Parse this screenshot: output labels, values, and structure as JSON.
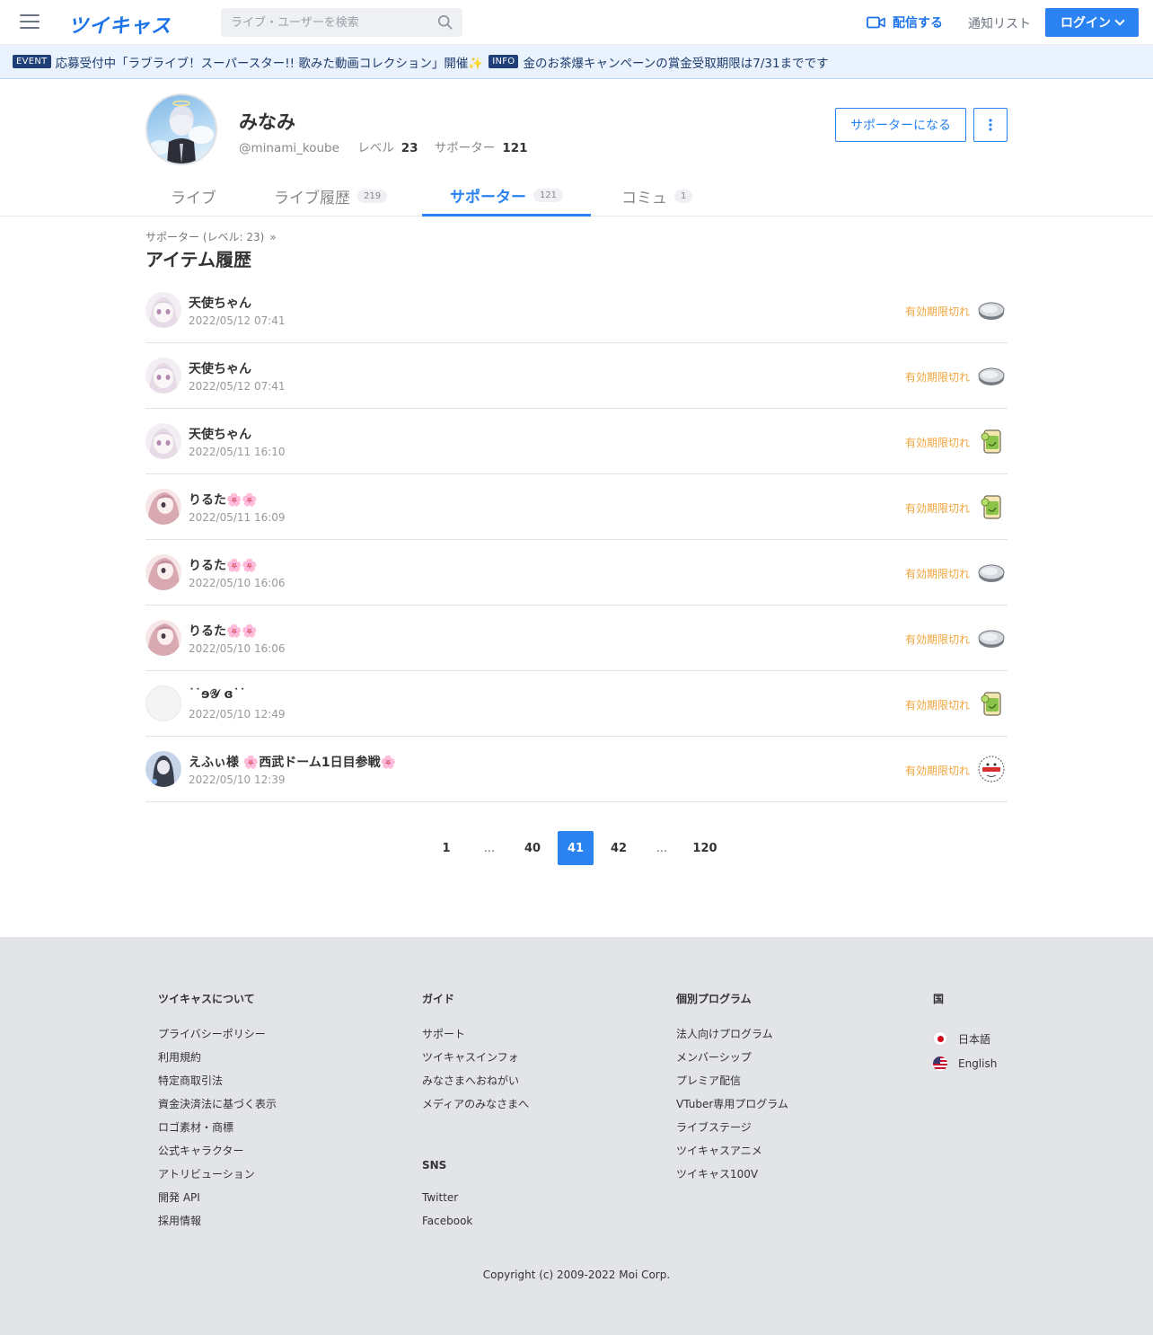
{
  "header": {
    "logo": "ツイキャス",
    "search_placeholder": "ライブ・ユーザーを検索",
    "broadcast": "配信する",
    "notify": "通知リスト",
    "login": "ログイン"
  },
  "eventbar": [
    {
      "tag": "EVENT",
      "text": "応募受付中「ラブライブ！スーパースター!! 歌みた動画コレクション」開催✨"
    },
    {
      "tag": "INFO",
      "text": "金のお茶爆キャンペーンの賞金受取期限は7/31までです"
    }
  ],
  "profile": {
    "name": "みなみ",
    "handle": "@minami_koube",
    "level_label": "レベル",
    "level": "23",
    "supporter_label": "サポーター",
    "supporters": "121",
    "become_supporter": "サポーターになる"
  },
  "tabs": [
    {
      "label": "ライブ",
      "count": ""
    },
    {
      "label": "ライブ履歴",
      "count": "219"
    },
    {
      "label": "サポーター",
      "count": "121"
    },
    {
      "label": "コミュ",
      "count": "1"
    }
  ],
  "breadcrumb": "サポーター (レベル: 23)",
  "breadcrumb_arrow": "»",
  "section_title": "アイテム履歴",
  "items": [
    {
      "name": "天使ちゃん",
      "date": "2022/05/12 07:41",
      "status": "有効期限切れ",
      "item": "coin-icon",
      "avatar": "angel"
    },
    {
      "name": "天使ちゃん",
      "date": "2022/05/12 07:41",
      "status": "有効期限切れ",
      "item": "coin-icon",
      "avatar": "angel"
    },
    {
      "name": "天使ちゃん",
      "date": "2022/05/11 16:10",
      "status": "有効期限切れ",
      "item": "tea-icon",
      "avatar": "angel"
    },
    {
      "name": "りるた🌸🌸",
      "date": "2022/05/11 16:09",
      "status": "有効期限切れ",
      "item": "tea-icon",
      "avatar": "pink"
    },
    {
      "name": "りるた🌸🌸",
      "date": "2022/05/10 16:06",
      "status": "有効期限切れ",
      "item": "coin-icon",
      "avatar": "pink"
    },
    {
      "name": "りるた🌸🌸",
      "date": "2022/05/10 16:06",
      "status": "有効期限切れ",
      "item": "coin-icon",
      "avatar": "pink"
    },
    {
      "name": "˙˙ɘ𝒴 ɞ˙˙",
      "date": "2022/05/10 12:49",
      "status": "有効期限切れ",
      "item": "tea-icon",
      "avatar": "blank"
    },
    {
      "name": "えふぃ様 🌸西武ドーム1日目参戦🌸",
      "date": "2022/05/10 12:39",
      "status": "有効期限切れ",
      "item": "gift-icon",
      "avatar": "dark"
    }
  ],
  "pagination": [
    "1",
    "...",
    "40",
    "41",
    "42",
    "...",
    "120"
  ],
  "pagination_active": "41",
  "footer": {
    "about": {
      "title": "ツイキャスについて",
      "links": [
        "プライバシーポリシー",
        "利用規約",
        "特定商取引法",
        "資金決済法に基づく表示",
        "ロゴ素材・商標",
        "公式キャラクター",
        "アトリビューション",
        "開発 API",
        "採用情報"
      ]
    },
    "guide": {
      "title": "ガイド",
      "links": [
        "サポート",
        "ツイキャスインフォ",
        "みなさまへおねがい",
        "メディアのみなさまへ"
      ]
    },
    "sns": {
      "title": "SNS",
      "links": [
        "Twitter",
        "Facebook"
      ]
    },
    "programs": {
      "title": "個別プログラム",
      "links": [
        "法人向けプログラム",
        "メンバーシップ",
        "プレミア配信",
        "VTuber専用プログラム",
        "ライブステージ",
        "ツイキャスアニメ",
        "ツイキャス100V"
      ]
    },
    "country": {
      "title": "国",
      "langs": [
        "日本語",
        "English"
      ]
    },
    "copyright": "Copyright (c) 2009-2022 Moi Corp."
  }
}
